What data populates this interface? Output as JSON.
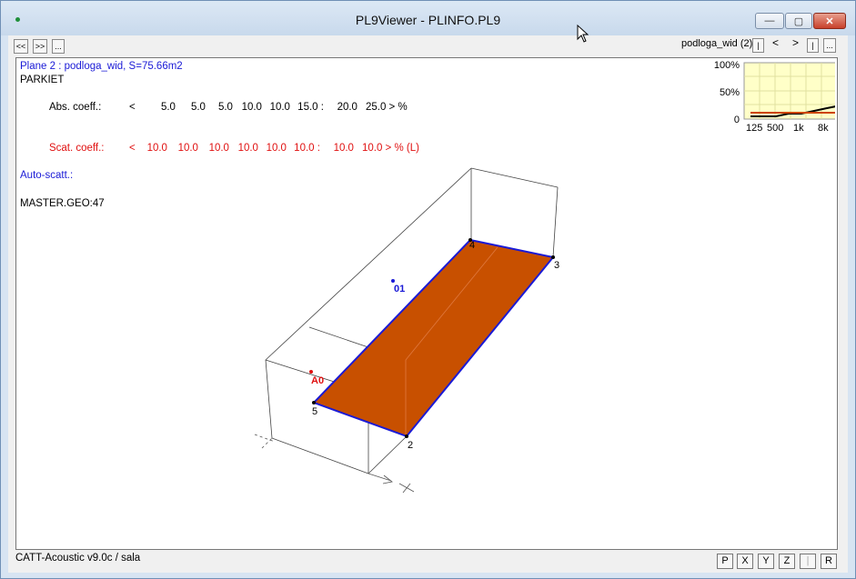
{
  "window": {
    "title": "PL9Viewer - PLINFO.PL9",
    "min_glyph": "—",
    "max_glyph": "▢",
    "close_glyph": "✕"
  },
  "toolbar": {
    "prev_label": "<<",
    "next_label": ">>",
    "more_label": "...",
    "plane_name": "podloga_wid (2)",
    "first_label": "|",
    "prev_plane": "<",
    "next_plane": ">",
    "last_label": "|",
    "options_label": "..."
  },
  "info": {
    "plane_line": "Plane 2 : podloga_wid, S=75.66m2",
    "material": "PARKIET",
    "abs": {
      "label": "Abs. coeff.:",
      "values": [
        "<",
        "5.0",
        "5.0",
        "5.0",
        "10.0",
        "10.0",
        "15.0 :",
        "20.0",
        "25.0 > %"
      ]
    },
    "scat": {
      "label": "Scat. coeff.:",
      "values": [
        "<",
        "10.0",
        "10.0",
        "10.0",
        "10.0",
        "10.0",
        "10.0 :",
        "10.0",
        "10.0 > % (L)"
      ]
    },
    "auto_scatt": "Auto-scatt.:",
    "geo": "MASTER.GEO:47"
  },
  "mini_chart": {
    "y_labels": [
      "100%",
      "50%",
      "0"
    ],
    "x_labels": [
      "125",
      "500",
      "1k",
      "8k"
    ],
    "abs_color": "#000000",
    "scat_color": "#cc4400"
  },
  "model": {
    "floor_color": "#c85000",
    "edge_color": "#1a1ad6",
    "corners": [
      "4",
      "3",
      "5",
      "2"
    ],
    "source": "A0",
    "receiver": "01"
  },
  "statusbar": {
    "text": "CATT-Acoustic v9.0c / sala",
    "buttons": [
      "P",
      "X",
      "Y",
      "Z",
      "|",
      "R"
    ]
  }
}
